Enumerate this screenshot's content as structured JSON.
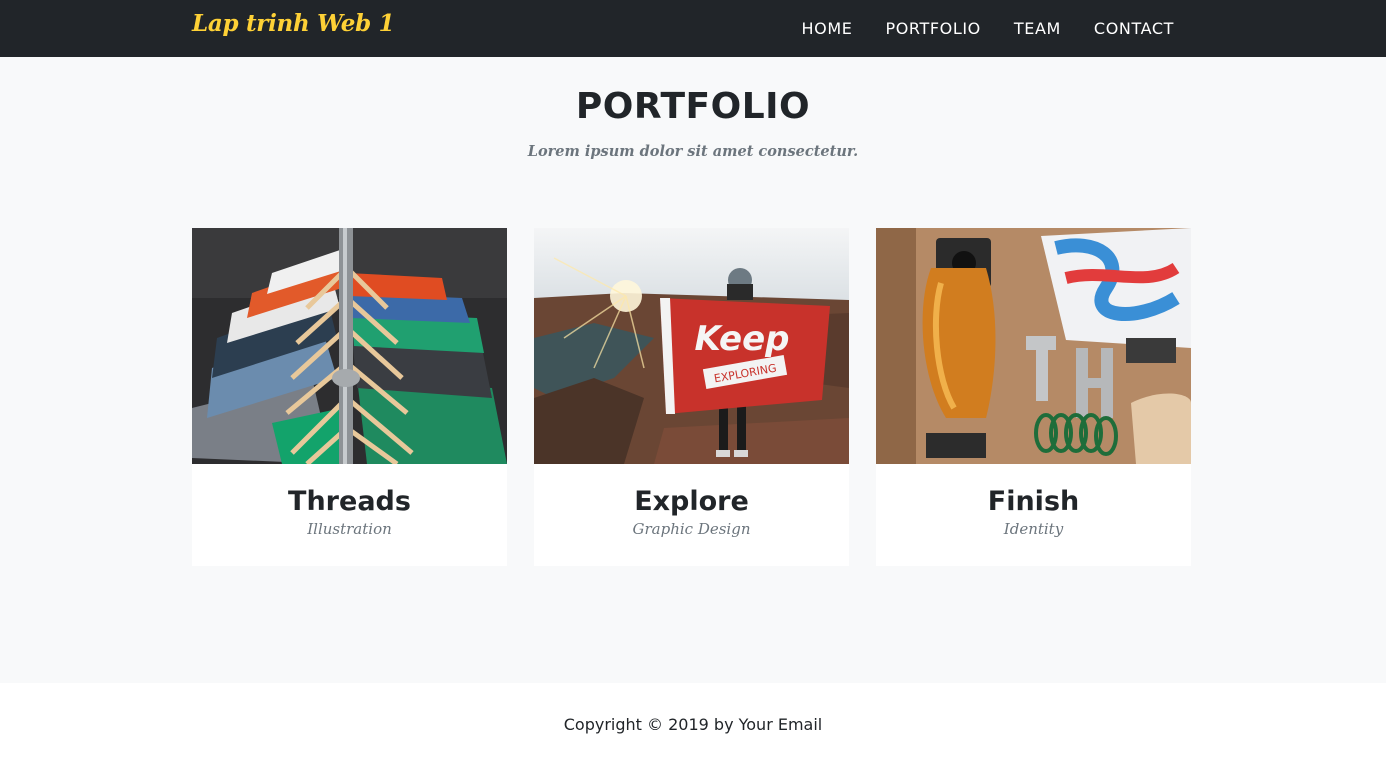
{
  "navbar": {
    "brand": "Lap trinh Web 1",
    "links": [
      "HOME",
      "PORTFOLIO",
      "TEAM",
      "CONTACT"
    ]
  },
  "portfolio": {
    "heading": "PORTFOLIO",
    "subheading": "Lorem ipsum dolor sit amet consectetur.",
    "items": [
      {
        "title": "Threads",
        "category": "Illustration"
      },
      {
        "title": "Explore",
        "category": "Graphic Design"
      },
      {
        "title": "Finish",
        "category": "Identity"
      }
    ],
    "image_texts": {
      "flag_main": "Keep",
      "flag_banner": "EXPLORING"
    }
  },
  "footer": {
    "copyright": "Copyright © 2019 by Your Email"
  },
  "colors": {
    "navbar_bg": "#212529",
    "brand": "#fed136",
    "page_bg": "#f8f9fa",
    "muted": "#6c757d"
  }
}
